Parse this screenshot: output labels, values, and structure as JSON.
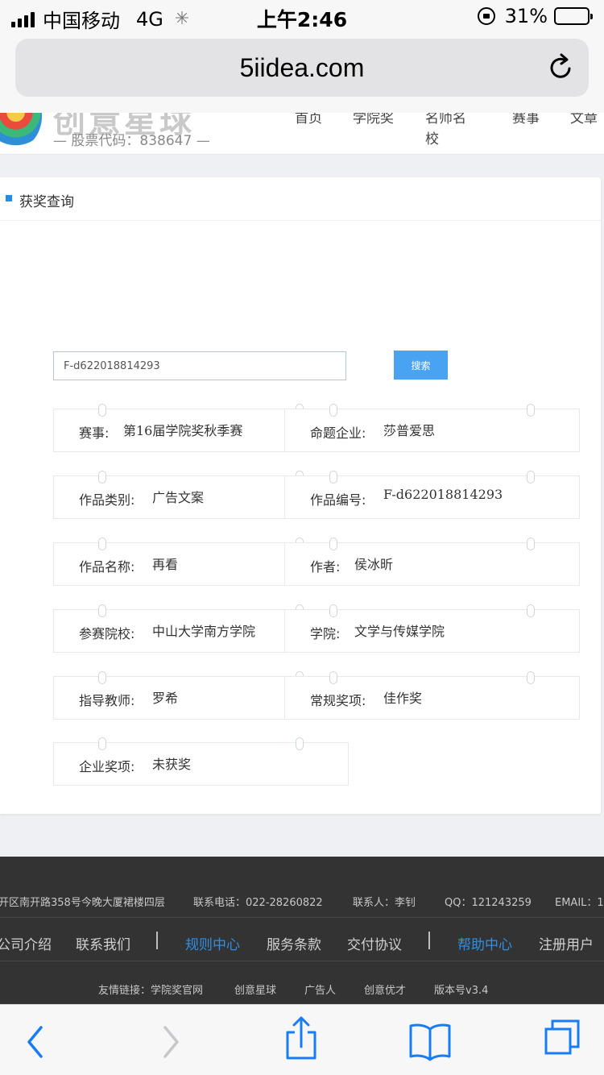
{
  "status_bar": {
    "carrier": "中国移动",
    "network": "4G",
    "time": "上午2:46",
    "battery": "31%",
    "battery_level": 0.31,
    "icons": [
      "signal-icon",
      "loading-spinner-icon",
      "orientation-lock-icon",
      "battery-icon"
    ]
  },
  "browser": {
    "url": "5iidea.com",
    "icons": [
      "reload-icon",
      "back-icon",
      "forward-icon",
      "share-icon",
      "bookmarks-icon",
      "tabs-icon"
    ]
  },
  "site_header": {
    "stock_code": "—  股票代码：838647  —",
    "nav": [
      {
        "label": "首页"
      },
      {
        "label": "学院奖"
      },
      {
        "label": "名师名校"
      },
      {
        "label": "赛事"
      },
      {
        "label": "文章"
      }
    ]
  },
  "panel": {
    "title": "获奖查询",
    "search": {
      "value": "F-d622018814293",
      "button": "搜索"
    },
    "rows": [
      [
        {
          "label": "赛事:",
          "value": "第16届学院奖秋季赛"
        },
        {
          "label": "命题企业:",
          "value": "莎普爱思"
        }
      ],
      [
        {
          "label": "作品类别:",
          "value": "广告文案"
        },
        {
          "label": "作品编号:",
          "value": "F-d622018814293"
        }
      ],
      [
        {
          "label": "作品名称:",
          "value": "再看"
        },
        {
          "label": "作者:",
          "value": "侯冰昕"
        }
      ],
      [
        {
          "label": "参赛院校:",
          "value": "中山大学南方学院"
        },
        {
          "label": "学院:",
          "value": "文学与传媒学院"
        }
      ],
      [
        {
          "label": "指导教师:",
          "value": "罗希"
        },
        {
          "label": "常规奖项:",
          "value": "佳作奖"
        }
      ],
      [
        {
          "label": "企业奖项:",
          "value": "未获奖"
        }
      ]
    ]
  },
  "footer": {
    "address": "开区南开路358号今晚大厦裙楼四层",
    "phone": "联系电话：022-28260822",
    "contact": "联系人：李钊",
    "qq": "QQ：121243259",
    "email": "EMAIL：1",
    "links": [
      {
        "label": "公司介绍",
        "highlight": false
      },
      {
        "label": "联系我们",
        "highlight": false
      },
      {
        "label": "规则中心",
        "highlight": true
      },
      {
        "label": "服务条款",
        "highlight": false
      },
      {
        "label": "交付协议",
        "highlight": false
      },
      {
        "label": "帮助中心",
        "highlight": true
      },
      {
        "label": "注册用户",
        "highlight": false
      }
    ],
    "friends_label": "友情链接：学院奖官网",
    "friends": [
      "创意星球",
      "广告人",
      "创意优才"
    ],
    "version": "版本号v3.4",
    "highlight_color": "#2f8fe6"
  },
  "colors": {
    "accent": "#1e8ef0",
    "search_button": "#4aa3f2",
    "footer_bg": "#333333",
    "ios_blue": "#1a7cf5"
  }
}
